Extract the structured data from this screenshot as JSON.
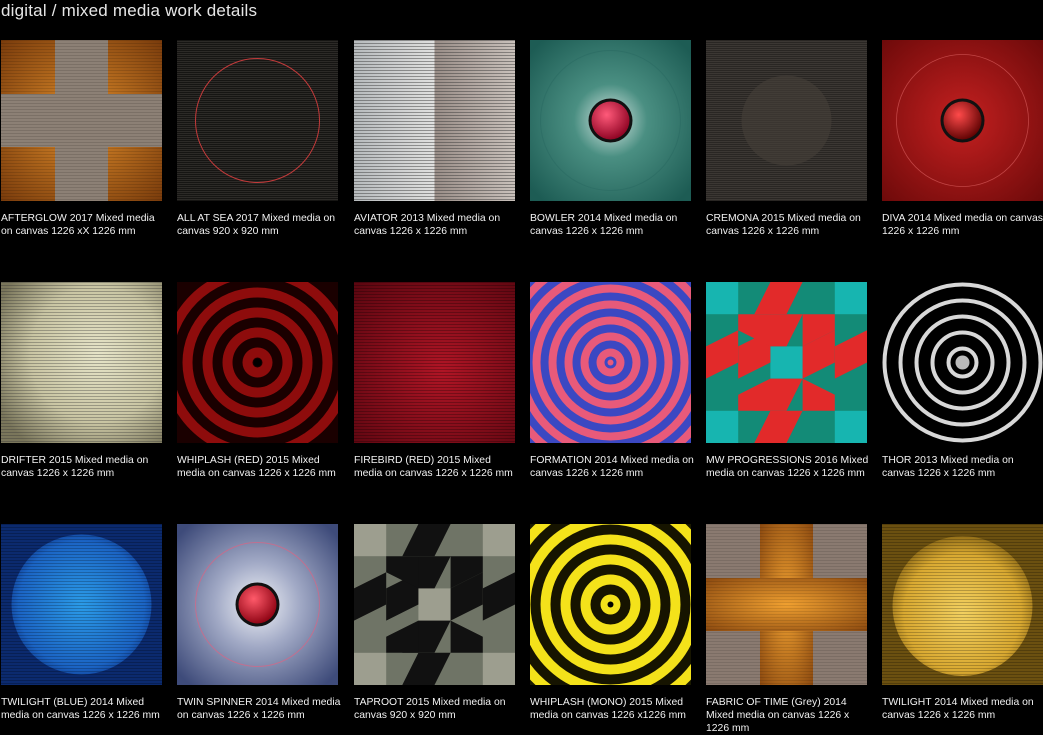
{
  "page": {
    "title": "digital / mixed media work details"
  },
  "works": [
    {
      "caption": "AFTERGLOW 2017 Mixed media on canvas 1226 xX 1226 mm",
      "art": "afterglow"
    },
    {
      "caption": "ALL AT SEA 2017 Mixed media on canvas 920 x 920 mm",
      "art": "allatsea"
    },
    {
      "caption": "AVIATOR 2013 Mixed media on canvas 1226 x 1226 mm",
      "art": "aviator"
    },
    {
      "caption": "BOWLER 2014 Mixed media on canvas 1226 x 1226 mm",
      "art": "bowler"
    },
    {
      "caption": "CREMONA 2015 Mixed media on canvas 1226 x 1226 mm",
      "art": "cremona"
    },
    {
      "caption": "DIVA 2014 Mixed media on canvas 1226 x 1226 mm",
      "art": "diva"
    },
    {
      "caption": "DRIFTER 2015 Mixed media on canvas 1226 x 1226 mm",
      "art": "drifter"
    },
    {
      "caption": "WHIPLASH (RED) 2015 Mixed media on canvas 1226 x 1226 mm",
      "art": "whiplashred"
    },
    {
      "caption": "FIREBIRD (RED) 2015 Mixed media on canvas 1226 x 1226 mm",
      "art": "firebird"
    },
    {
      "caption": "FORMATION 2014 Mixed media on canvas 1226 x 1226 mm",
      "art": "formation"
    },
    {
      "caption": "MW PROGRESSIONS 2016 Mixed media on canvas 1226 x 1226 mm",
      "art": "progressions"
    },
    {
      "caption": "THOR 2013 Mixed media on canvas 1226 x 1226 mm",
      "art": "thor"
    },
    {
      "caption": "TWILIGHT (BLUE) 2014 Mixed media on canvas 1226 x 1226 mm",
      "art": "twilightblue"
    },
    {
      "caption": "TWIN SPINNER 2014 Mixed media on canvas 1226 x 1226 mm",
      "art": "twinspinner"
    },
    {
      "caption": "TAPROOT 2015 Mixed media on canvas 920 x 920 mm",
      "art": "taproot"
    },
    {
      "caption": "WHIPLASH (MONO) 2015 Mixed media on canvas 1226 x1226 mm",
      "art": "whiplashmono"
    },
    {
      "caption": "FABRIC OF TIME (Grey) 2014 Mixed media on canvas 1226 x 1226 mm",
      "art": "fabric"
    },
    {
      "caption": "TWILIGHT 2014 Mixed media on canvas 1226 x 1226 mm",
      "art": "twilight"
    }
  ]
}
